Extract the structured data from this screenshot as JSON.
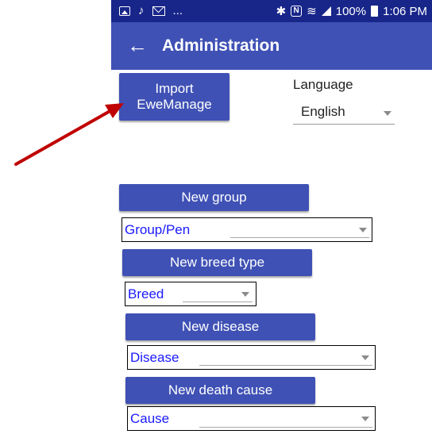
{
  "status_bar": {
    "left_icons": [
      "image-icon",
      "signal-icon",
      "mail-icon"
    ],
    "ellipsis": "...",
    "battery": "100%",
    "time": "1:06 PM"
  },
  "app_bar": {
    "back_glyph": "←",
    "title": "Administration"
  },
  "import_button": {
    "line1": "Import",
    "line2": "EweManage"
  },
  "language": {
    "label": "Language",
    "value": "English"
  },
  "groups": {
    "new_button": "New group",
    "select_value": "Group/Pen"
  },
  "breeds": {
    "new_button": "New breed type",
    "select_value": "Breed"
  },
  "diseases": {
    "new_button": "New disease",
    "select_value": "Disease"
  },
  "death_causes": {
    "new_button": "New death cause",
    "select_value": "Cause"
  },
  "colors": {
    "primary": "#3f51b5",
    "status_bar": "#18268a",
    "spinner_text": "#1a1aff",
    "annotation_arrow": "#c00000"
  }
}
